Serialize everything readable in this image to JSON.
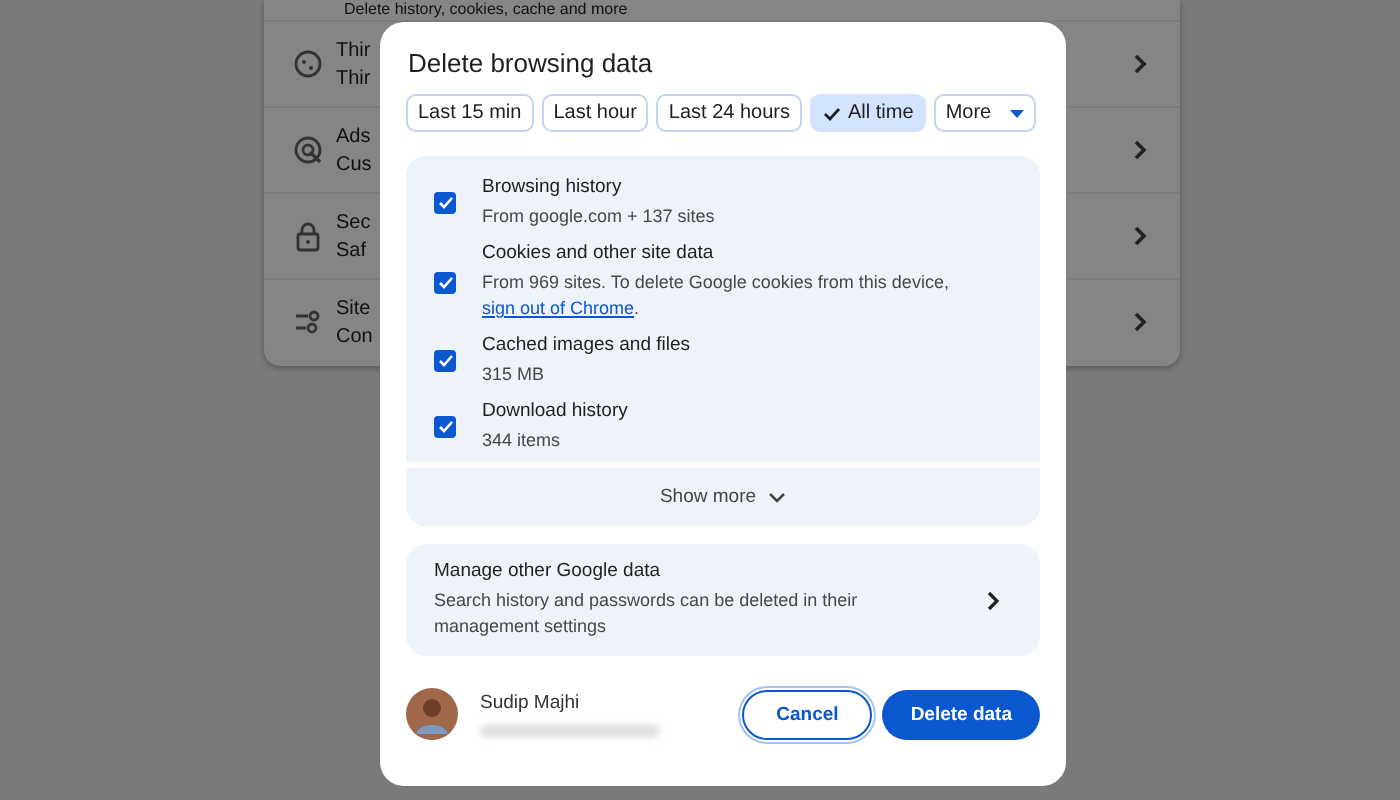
{
  "background_settings": {
    "top_row_text": "Delete history, cookies, cache and more",
    "rows": [
      {
        "title": "Thir",
        "subtitle": "Thir"
      },
      {
        "title": "Ads",
        "subtitle": "Cus"
      },
      {
        "title": "Sec",
        "subtitle": "Saf"
      },
      {
        "title": "Site",
        "subtitle": "Con"
      }
    ]
  },
  "dialog": {
    "title": "Delete browsing data",
    "time_ranges": [
      {
        "label": "Last 15 min",
        "selected": false
      },
      {
        "label": "Last hour",
        "selected": false
      },
      {
        "label": "Last 24 hours",
        "selected": false
      },
      {
        "label": "All time",
        "selected": true
      }
    ],
    "more_button": "More",
    "items": [
      {
        "title": "Browsing history",
        "detail": "From google.com + 137 sites",
        "checked": true
      },
      {
        "title": "Cookies and other site data",
        "detail": "From 969 sites. To delete Google cookies from this device, ",
        "link": "sign out of Chrome",
        "after_link": ".",
        "checked": true
      },
      {
        "title": "Cached images and files",
        "detail": "315 MB",
        "checked": true
      },
      {
        "title": "Download history",
        "detail": "344 items",
        "checked": true
      }
    ],
    "show_more": "Show more",
    "manage": {
      "title": "Manage other Google data",
      "detail": "Search history and passwords can be deleted in their management settings"
    },
    "account": {
      "name": "Sudip Majhi"
    },
    "buttons": [
      {
        "kind": "secondary",
        "label": "Cancel"
      },
      {
        "kind": "primary",
        "label": "Delete data"
      }
    ]
  }
}
